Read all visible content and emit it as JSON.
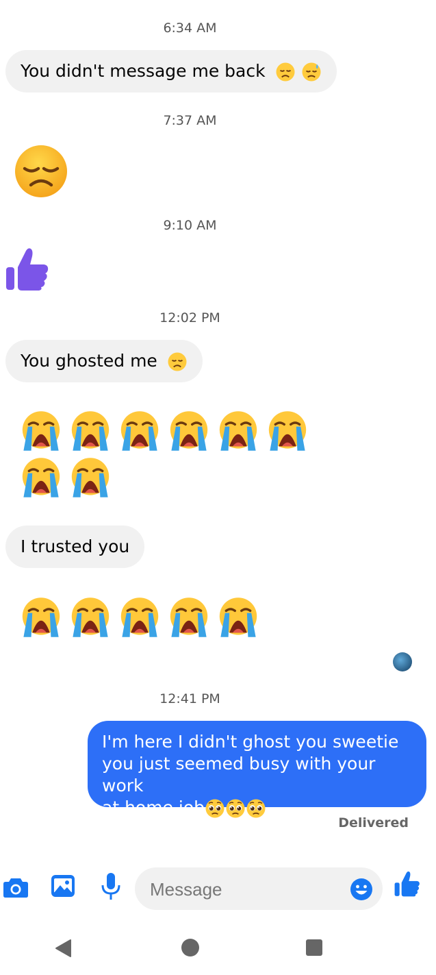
{
  "conversation": {
    "timestamps": [
      "6:34 AM",
      "7:37 AM",
      "9:10 AM",
      "12:02 PM",
      "12:41 PM"
    ],
    "incoming": [
      {
        "text": "You didn't message me back",
        "emoji": [
          "disappointed-face",
          "downcast-face-with-sweat"
        ]
      },
      {
        "text": "You ghosted me",
        "emoji": [
          "disappointed-face"
        ]
      },
      {
        "text": "I trusted you"
      }
    ],
    "big_emoji": {
      "disappointed": "disappointed-face",
      "thumbs_up": "thumbs-up-purple",
      "crying_row_1_count": 6,
      "crying_row_2_count": 2,
      "crying_row_3_count": 5
    },
    "outgoing": {
      "line1": "I'm here I didn't ghost you sweetie",
      "line2": "you just seemed busy with your work",
      "line3": "at home job",
      "emoji": [
        "pleading-face",
        "pleading-face",
        "pleading-face"
      ],
      "status": "Delivered"
    }
  },
  "composer": {
    "placeholder": "Message",
    "icons": [
      "camera-icon",
      "image-icon",
      "microphone-icon",
      "emoji-icon",
      "thumbs-up-icon"
    ]
  },
  "colors": {
    "accent": "#1877f2",
    "outgoing_bubble": "#2d6ff7",
    "incoming_bubble": "#f1f1f1",
    "thumbs_purple": "#7b55e8"
  },
  "navbar": {
    "icons": [
      "back-icon",
      "home-icon",
      "recents-icon"
    ]
  }
}
